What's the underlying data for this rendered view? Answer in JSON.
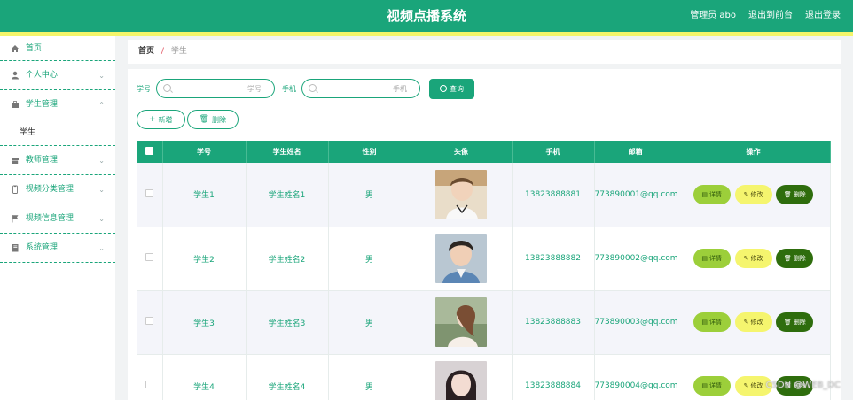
{
  "header": {
    "title": "视频点播系统",
    "user_label": "管理员 abo",
    "back_label": "退出到前台",
    "logout_label": "退出登录"
  },
  "sidebar": {
    "items": [
      {
        "label": "首页",
        "icon": "home-icon"
      },
      {
        "label": "个人中心",
        "icon": "user-icon"
      },
      {
        "label": "学生管理",
        "icon": "briefcase-icon",
        "expanded": true,
        "children": [
          {
            "label": "学生"
          }
        ]
      },
      {
        "label": "教师管理",
        "icon": "archive-icon"
      },
      {
        "label": "视频分类管理",
        "icon": "clipboard-icon"
      },
      {
        "label": "视频信息管理",
        "icon": "flag-icon"
      },
      {
        "label": "系统管理",
        "icon": "book-icon"
      }
    ]
  },
  "breadcrumb": {
    "home": "首页",
    "separator": "/",
    "current": "学生"
  },
  "search": {
    "student_no_label": "学号",
    "student_no_placeholder": "学号",
    "phone_label": "手机",
    "phone_placeholder": "手机",
    "query_label": "查询"
  },
  "actions": {
    "add_label": "新增",
    "delete_label": "删除"
  },
  "table": {
    "columns": [
      "学号",
      "学生姓名",
      "性别",
      "头像",
      "手机",
      "邮箱",
      "操作"
    ],
    "rows": [
      {
        "no": "学生1",
        "name": "学生姓名1",
        "gender": "男",
        "phone": "13823888881",
        "email": "773890001@qq.com"
      },
      {
        "no": "学生2",
        "name": "学生姓名2",
        "gender": "男",
        "phone": "13823888882",
        "email": "773890002@qq.com"
      },
      {
        "no": "学生3",
        "name": "学生姓名3",
        "gender": "男",
        "phone": "13823888883",
        "email": "773890003@qq.com"
      },
      {
        "no": "学生4",
        "name": "学生姓名4",
        "gender": "男",
        "phone": "13823888884",
        "email": "773890004@qq.com"
      }
    ],
    "row_actions": {
      "detail": "详情",
      "edit": "修改",
      "delete": "删除"
    }
  },
  "watermark": "CSDN @WEB_DC",
  "colors": {
    "primary": "#1aa57a",
    "accent_strip": "#f4f56a",
    "detail": "#9ccf3a",
    "edit": "#f5f56e",
    "delete": "#2e6d0d"
  }
}
